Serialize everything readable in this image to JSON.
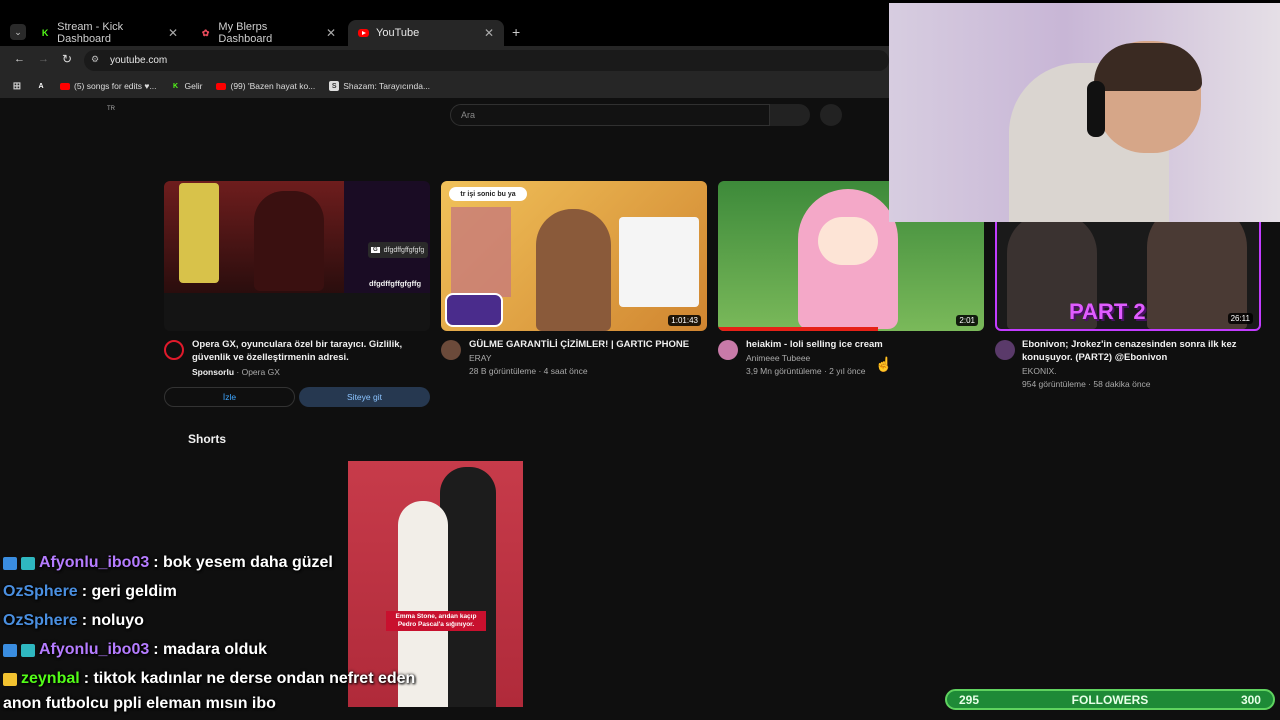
{
  "browser": {
    "tabs": [
      {
        "label": "Stream - Kick Dashboard",
        "icon": "kick-icon",
        "active": false
      },
      {
        "label": "My Blerps Dashboard",
        "icon": "blerp-icon",
        "active": false
      },
      {
        "label": "YouTube",
        "icon": "youtube-icon",
        "active": true
      }
    ],
    "url": "youtube.com",
    "bookmarks": [
      {
        "label": "",
        "icon": "apps-grid-icon"
      },
      {
        "label": "",
        "icon": "letter-a-icon"
      },
      {
        "label": "(5) songs for edits ♥...",
        "icon": "youtube-icon"
      },
      {
        "label": "Gelir",
        "icon": "kick-icon"
      },
      {
        "label": "(99) 'Bazen hayat ko...",
        "icon": "youtube-icon"
      },
      {
        "label": "Shazam: Tarayıcında...",
        "icon": "shazam-icon"
      }
    ]
  },
  "youtube": {
    "region": "TR",
    "search_placeholder": "Ara",
    "ad": {
      "title": "Opera GX, oyunculara özel bir tarayıcı. Gizlilik, güvenlik ve özelleştirmenin adresi.",
      "sponsor_label": "Sponsorlu",
      "sponsor_name": "· Opera GX",
      "thumb_text": "dfgdffgffgfgfg",
      "thumb_text2": "dfgdffgffgfgffg",
      "watch_button": "İzle",
      "visit_button": "Siteye git"
    },
    "videos": [
      {
        "title": "GÜLME GARANTİLİ ÇİZİMLER! | GARTIC PHONE",
        "channel": "ERAY",
        "meta": "28 B görüntüleme · 4 saat önce",
        "duration": "1:01:43",
        "thumb_text": "tr işi sonic bu ya"
      },
      {
        "title": "heiakim - loli selling ice cream",
        "channel": "Animeee Tubeee",
        "meta": "3,9 Mn görüntüleme · 2 yıl önce",
        "duration": "2:01"
      },
      {
        "title": "Ebonivon; Jrokez'in cenazesinden sonra ilk kez konuşuyor. (PART2) @Ebonivon",
        "channel": "EKONIX.",
        "meta": "954 görüntüleme · 58 dakika önce",
        "duration": "26:11",
        "thumb_text": "PART 2"
      }
    ],
    "shorts_label": "Shorts",
    "short_caption": "Emma Stone, arıdan kaçıp Pedro Pascal'a sığınıyor."
  },
  "chat": [
    {
      "user": "Afyonlu_ibo03",
      "message": ": bok yesem daha güzel",
      "user_color": "#b57cff",
      "badges": true
    },
    {
      "user": "OzSphere",
      "message": ": geri geldim",
      "user_color": "#4a8fe0",
      "badges": false
    },
    {
      "user": "OzSphere",
      "message": ": noluyo",
      "user_color": "#4a8fe0",
      "badges": false
    },
    {
      "user": "Afyonlu_ibo03",
      "message": ": madara olduk",
      "user_color": "#b57cff",
      "badges": true
    },
    {
      "user": "zeynbal",
      "message": ": tiktok kadınlar ne derse ondan nefret eden",
      "user_color": "#53fc18",
      "badges": true
    },
    {
      "user": "",
      "message": "anon futbolcu ppli eleman mısın ibo",
      "user_color": "#ffffff",
      "badges": false
    }
  ],
  "followers": {
    "current": "295",
    "label": "FOLLOWERS",
    "goal": "300"
  }
}
